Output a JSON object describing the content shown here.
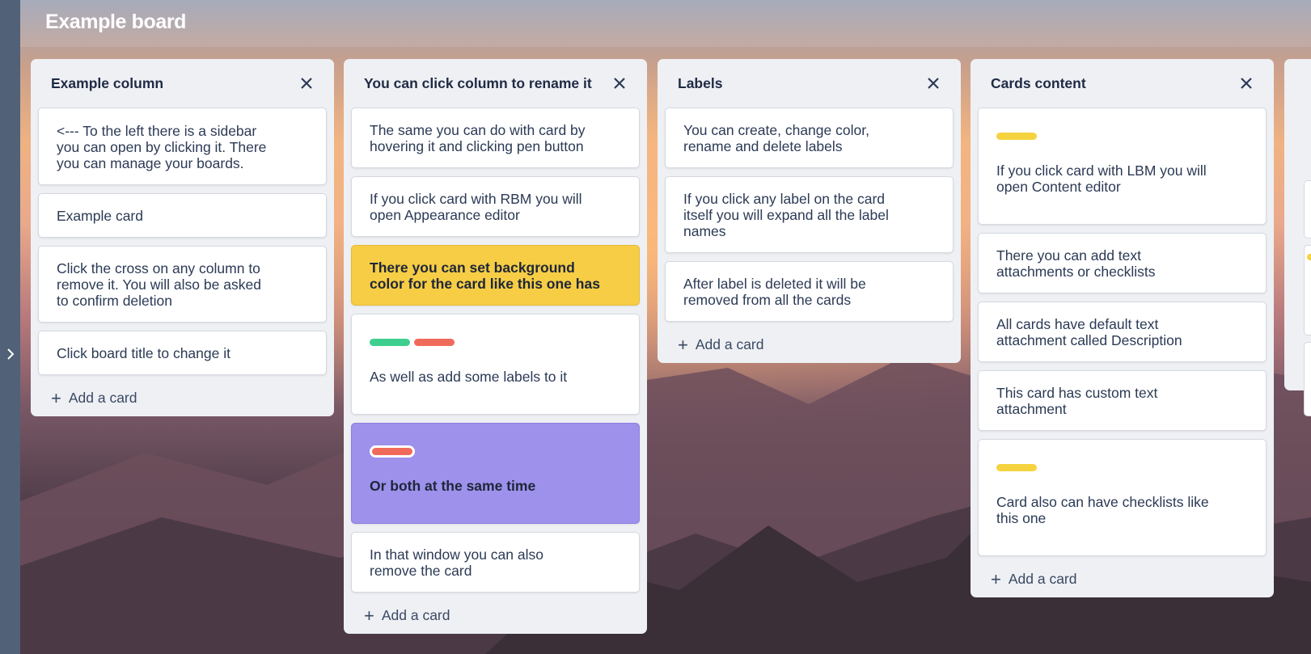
{
  "board": {
    "title": "Example board"
  },
  "columns": [
    {
      "title": "Example column",
      "cards": [
        {
          "text": "<--- To the left there is a sidebar\nyou can open by clicking it. There\nyou can manage your boards."
        },
        {
          "text": "Example card"
        },
        {
          "text": "Click the cross on any column to\nremove it. You will also be asked\nto confirm deletion"
        },
        {
          "text": "Click board title to change it"
        }
      ],
      "add_label": "Add a card"
    },
    {
      "title": "You can click column to rename it",
      "cards": [
        {
          "text": "The same you can do with card by\nhovering it and clicking pen button"
        },
        {
          "text": "If you click card with RBM you will\nopen Appearance editor"
        },
        {
          "text": "There you can set background\ncolor for the card like this one has",
          "background": "#f6cd45"
        },
        {
          "text": "As well as add some labels to it",
          "labels": [
            "#3ecf8e",
            "#f06a5b"
          ]
        },
        {
          "text": "Or both at the same time",
          "background": "#9d91ec",
          "labels": [
            "#f06a5b"
          ]
        },
        {
          "text": "In that window you can also\nremove the card"
        }
      ],
      "add_label": "Add a card"
    },
    {
      "title": "Labels",
      "cards": [
        {
          "text": "You can create, change color,\nrename and delete labels"
        },
        {
          "text": "If you click any label on the card\nitself you will expand all the label\nnames"
        },
        {
          "text": "After label is deleted it will be\nremoved from all the cards"
        }
      ],
      "add_label": "Add a card"
    },
    {
      "title": "Cards content",
      "cards": [
        {
          "text": "If you click card with LBM you will\nopen Content editor",
          "labels": [
            "#f5d33f"
          ]
        },
        {
          "text": "There you can add text\nattachments or checklists"
        },
        {
          "text": "All cards have default text\nattachment called Description"
        },
        {
          "text": "This card has custom text\nattachment"
        },
        {
          "text": "Card also can have checklists like\nthis one",
          "labels": [
            "#f5d33f"
          ]
        }
      ],
      "add_label": "Add a card"
    }
  ],
  "icons": {
    "close": "close-icon",
    "add": "plus-icon",
    "sidebar_toggle": "chevron-right-icon"
  },
  "colors": {
    "column_bg": "#eef0f4",
    "title_text": "#1f2a44",
    "sidebar": "#506178"
  }
}
